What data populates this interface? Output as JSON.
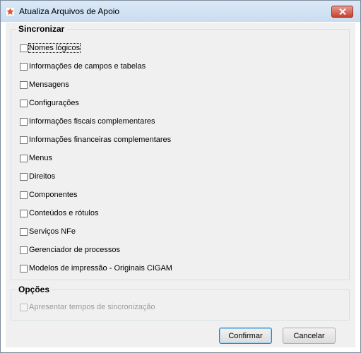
{
  "window": {
    "title": "Atualiza Arquivos de Apoio"
  },
  "sync": {
    "legend": "Sincronizar",
    "items": [
      {
        "label": "Nomes lógicos",
        "checked": false
      },
      {
        "label": "Informações de campos e tabelas",
        "checked": false
      },
      {
        "label": "Mensagens",
        "checked": false
      },
      {
        "label": "Configurações",
        "checked": false
      },
      {
        "label": "Informações fiscais complementares",
        "checked": false
      },
      {
        "label": "Informações financeiras complementares",
        "checked": false
      },
      {
        "label": "Menus",
        "checked": false
      },
      {
        "label": "Direitos",
        "checked": false
      },
      {
        "label": "Componentes",
        "checked": false
      },
      {
        "label": "Conteúdos e rótulos",
        "checked": false
      },
      {
        "label": "Serviços NFe",
        "checked": false
      },
      {
        "label": "Gerenciador de processos",
        "checked": false
      },
      {
        "label": "Modelos de impressão - Originais CIGAM",
        "checked": false
      }
    ]
  },
  "options": {
    "legend": "Opções",
    "items": [
      {
        "label": "Apresentar tempos de sincronização",
        "checked": false,
        "enabled": false
      }
    ]
  },
  "buttons": {
    "confirm": "Confirmar",
    "cancel": "Cancelar"
  },
  "colors": {
    "close_button": "#c7432f",
    "group_border": "#d5dfe5",
    "client_bg": "#f0f0f0"
  }
}
